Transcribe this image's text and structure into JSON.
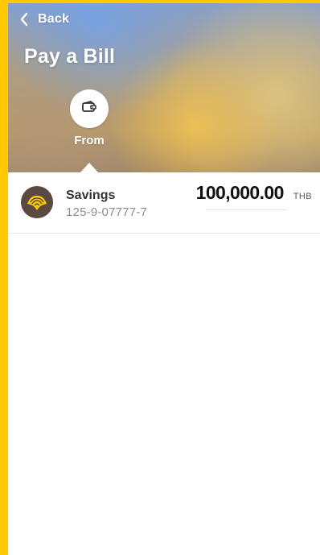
{
  "header": {
    "back_label": "Back",
    "title": "Pay a Bill",
    "step_label": "From"
  },
  "account": {
    "name": "Savings",
    "number": "125-9-07777-7",
    "balance": "100,000.00",
    "currency": "THB"
  },
  "colors": {
    "frame_yellow": "#ffc800",
    "logo_background": "#5a4a40",
    "logo_yellow": "#ffcc00",
    "text_dark": "#111111",
    "text_gray": "#8c8c8c"
  },
  "icons": {
    "back": "chevron-left-icon",
    "from": "wallet-icon",
    "bank_logo": "bank-logo-icon"
  }
}
